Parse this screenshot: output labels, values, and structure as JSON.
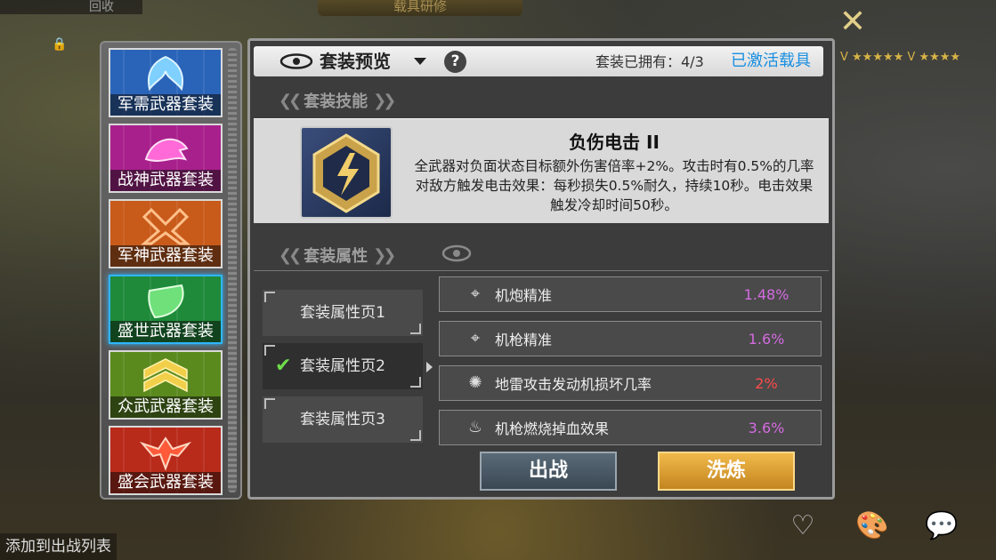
{
  "background": {
    "top_left_label": "回收",
    "top_title": "载具研修",
    "right_stars": "V ★★★★★  V ★★★★",
    "bottom_left_text": "添加到出战列表",
    "bottom_icons": [
      "heart-icon",
      "paint-icon",
      "chat-icon"
    ]
  },
  "suits": [
    {
      "label": "军需武器套装",
      "color": "#2a64b8",
      "icon": "wing-emblem-icon"
    },
    {
      "label": "战神武器套装",
      "color": "#a8208c",
      "icon": "beast-emblem-icon"
    },
    {
      "label": "军神武器套装",
      "color": "#c85a1a",
      "icon": "cross-emblem-icon"
    },
    {
      "label": "盛世武器套装",
      "color": "#1e8a3a",
      "icon": "shield-emblem-icon"
    },
    {
      "label": "众武武器套装",
      "color": "#5a8a1e",
      "icon": "chevron-emblem-icon"
    },
    {
      "label": "盛会武器套装",
      "color": "#b82a1a",
      "icon": "eagle-emblem-icon"
    }
  ],
  "header": {
    "title": "套装预览",
    "owned": "套装已拥有：4/3",
    "activated_link": "已激活载具"
  },
  "skill_section": {
    "label": "套装技能",
    "name": "负伤电击 II",
    "description": "全武器对负面状态目标额外伤害倍率+2%。攻击时有0.5%的几率对敌方触发电击效果：每秒损失0.5%耐久，持续10秒。电击效果触发冷却时间50秒。"
  },
  "attr_section": {
    "label": "套装属性",
    "pages": [
      "套装属性页1",
      "套装属性页2",
      "套装属性页3"
    ],
    "active_page_index": 1,
    "rows": [
      {
        "icon": "crosshair-icon",
        "name": "机炮精准",
        "value": "1.48%",
        "color": "#d36be0"
      },
      {
        "icon": "crosshair-icon",
        "name": "机枪精准",
        "value": "1.6%",
        "color": "#d36be0"
      },
      {
        "icon": "mine-icon",
        "name": "地雷攻击发动机损坏几率",
        "value": "2%",
        "color": "#ff4a4a"
      },
      {
        "icon": "burn-icon",
        "name": "机枪燃烧掉血效果",
        "value": "3.6%",
        "color": "#d36be0"
      }
    ]
  },
  "actions": {
    "battle": "出战",
    "refine": "洗炼"
  }
}
